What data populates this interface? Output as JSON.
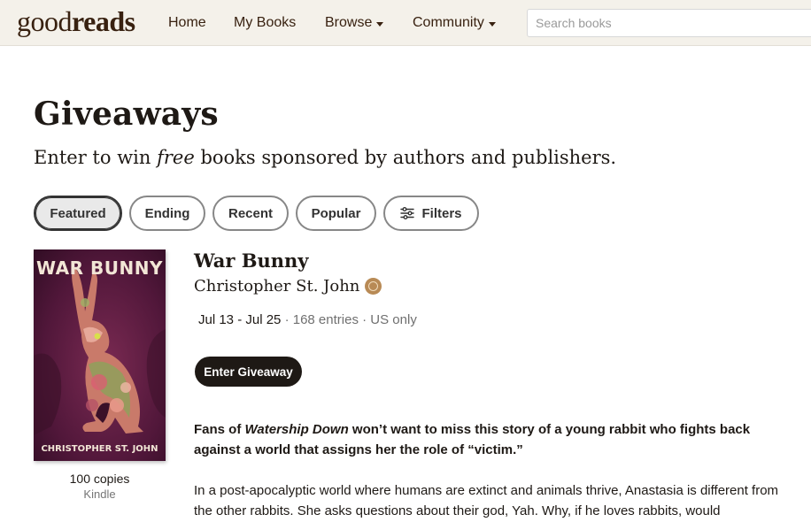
{
  "header": {
    "logo_light": "good",
    "logo_bold": "reads",
    "nav": [
      {
        "label": "Home"
      },
      {
        "label": "My Books"
      },
      {
        "label": "Browse"
      },
      {
        "label": "Community"
      }
    ],
    "search_placeholder": "Search books"
  },
  "page": {
    "title": "Giveaways",
    "subtitle_before": "Enter to win ",
    "subtitle_em": "free",
    "subtitle_after": " books sponsored by authors and publishers."
  },
  "tabs": [
    {
      "label": "Featured",
      "active": true
    },
    {
      "label": "Ending",
      "active": false
    },
    {
      "label": "Recent",
      "active": false
    },
    {
      "label": "Popular",
      "active": false
    },
    {
      "label": "Filters",
      "icon": "sliders-icon",
      "active": false
    }
  ],
  "giveaway": {
    "cover_title": "WAR BUNNY",
    "cover_author": "CHRISTOPHER ST. JOHN",
    "copies": "100 copies",
    "format": "Kindle",
    "title": "War Bunny",
    "author": "Christopher St. John",
    "author_badge_icon": "goodreads-author-badge-icon",
    "dates": "Jul 13 - Jul 25",
    "entries": "168 entries",
    "region": "US only",
    "enter_label": "Enter Giveaway",
    "desc_bold_before": "Fans of ",
    "desc_bold_em": "Watership Down",
    "desc_bold_after": " won’t want to miss this story of a young rabbit who fights back against a world that assigns her the role of “victim.”",
    "desc": "In a post-apocalyptic world where humans are extinct and animals thrive, Anastasia is different from the other rabbits. She asks questions about their god, Yah. Why, if he loves rabbits, would"
  },
  "colors": {
    "header_bg": "#f4f1ea",
    "brand_text": "#382110",
    "primary_button": "#1e1915",
    "cover_bg": "#5a1a38"
  }
}
